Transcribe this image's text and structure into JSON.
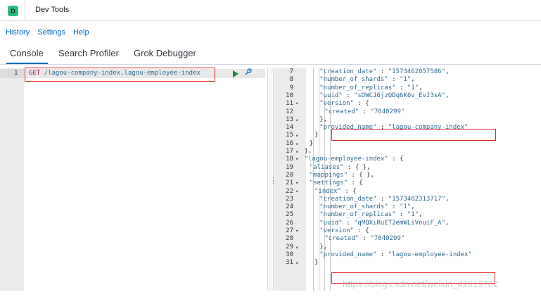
{
  "app": {
    "badge": "D",
    "title": "Dev Tools"
  },
  "menu": [
    "History",
    "Settings",
    "Help"
  ],
  "tabs": [
    "Console",
    "Search Profiler",
    "Grok Debugger"
  ],
  "request": {
    "line_number": "1",
    "method": "GET",
    "path": " /lagou-company-index,lagou-employee-index"
  },
  "response": {
    "lines": [
      {
        "n": "7",
        "fold": "",
        "indent": 6,
        "text": [
          [
            "k",
            "\"creation_date\""
          ],
          [
            "p",
            " : "
          ],
          [
            "s",
            "\"1573462057586\""
          ],
          [
            "p",
            ","
          ]
        ]
      },
      {
        "n": "8",
        "fold": "",
        "indent": 6,
        "text": [
          [
            "k",
            "\"number_of_shards\""
          ],
          [
            "p",
            " : "
          ],
          [
            "s",
            "\"1\""
          ],
          [
            "p",
            ","
          ]
        ]
      },
      {
        "n": "9",
        "fold": "",
        "indent": 6,
        "text": [
          [
            "k",
            "\"number_of_replicas\""
          ],
          [
            "p",
            " : "
          ],
          [
            "s",
            "\"1\""
          ],
          [
            "p",
            ","
          ]
        ]
      },
      {
        "n": "10",
        "fold": "",
        "indent": 6,
        "text": [
          [
            "k",
            "\"uuid\""
          ],
          [
            "p",
            " : "
          ],
          [
            "s",
            "\"sDWCJ6jzQDq6K6v_EvJ3sA\""
          ],
          [
            "p",
            ","
          ]
        ]
      },
      {
        "n": "11",
        "fold": "▾",
        "indent": 6,
        "text": [
          [
            "k",
            "\"version\""
          ],
          [
            "p",
            " : {"
          ]
        ]
      },
      {
        "n": "12",
        "fold": "",
        "indent": 7,
        "text": [
          [
            "k",
            "\"created\""
          ],
          [
            "p",
            " : "
          ],
          [
            "s",
            "\"7040299\""
          ]
        ]
      },
      {
        "n": "13",
        "fold": "▴",
        "indent": 6,
        "text": [
          [
            "p",
            "},"
          ]
        ]
      },
      {
        "n": "14",
        "fold": "",
        "indent": 6,
        "text": [
          [
            "k",
            "\"provided_name\""
          ],
          [
            "p",
            " : "
          ],
          [
            "s",
            "\"lagou-company-index\""
          ]
        ]
      },
      {
        "n": "15",
        "fold": "▴",
        "indent": 5,
        "text": [
          [
            "p",
            "}"
          ]
        ]
      },
      {
        "n": "16",
        "fold": "▴",
        "indent": 4,
        "text": [
          [
            "p",
            "}"
          ]
        ]
      },
      {
        "n": "17",
        "fold": "▴",
        "indent": 3,
        "text": [
          [
            "p",
            "},"
          ]
        ]
      },
      {
        "n": "18",
        "fold": "▾",
        "indent": 3,
        "text": [
          [
            "k",
            "\"lagou-employee-index\""
          ],
          [
            "p",
            " : {"
          ]
        ]
      },
      {
        "n": "19",
        "fold": "",
        "indent": 4,
        "text": [
          [
            "k",
            "\"aliases\""
          ],
          [
            "p",
            " : { },"
          ]
        ]
      },
      {
        "n": "20",
        "fold": "",
        "indent": 4,
        "text": [
          [
            "k",
            "\"mappings\""
          ],
          [
            "p",
            " : { },"
          ]
        ]
      },
      {
        "n": "21",
        "fold": "▾",
        "indent": 4,
        "text": [
          [
            "k",
            "\"settings\""
          ],
          [
            "p",
            " : {"
          ]
        ]
      },
      {
        "n": "22",
        "fold": "▾",
        "indent": 5,
        "text": [
          [
            "k",
            "\"index\""
          ],
          [
            "p",
            " : {"
          ]
        ]
      },
      {
        "n": "23",
        "fold": "",
        "indent": 6,
        "text": [
          [
            "k",
            "\"creation_date\""
          ],
          [
            "p",
            " : "
          ],
          [
            "s",
            "\"1573462313717\""
          ],
          [
            "p",
            ","
          ]
        ]
      },
      {
        "n": "24",
        "fold": "",
        "indent": 6,
        "text": [
          [
            "k",
            "\"number_of_shards\""
          ],
          [
            "p",
            " : "
          ],
          [
            "s",
            "\"1\""
          ],
          [
            "p",
            ","
          ]
        ]
      },
      {
        "n": "25",
        "fold": "",
        "indent": 6,
        "text": [
          [
            "k",
            "\"number_of_replicas\""
          ],
          [
            "p",
            " : "
          ],
          [
            "s",
            "\"1\""
          ],
          [
            "p",
            ","
          ]
        ]
      },
      {
        "n": "26",
        "fold": "",
        "indent": 6,
        "text": [
          [
            "k",
            "\"uuid\""
          ],
          [
            "p",
            " : "
          ],
          [
            "s",
            "\"qMQXiRuET2emWLiVnuiF_A\""
          ],
          [
            "p",
            ","
          ]
        ]
      },
      {
        "n": "27",
        "fold": "▾",
        "indent": 6,
        "text": [
          [
            "k",
            "\"version\""
          ],
          [
            "p",
            " : {"
          ]
        ]
      },
      {
        "n": "28",
        "fold": "",
        "indent": 7,
        "text": [
          [
            "k",
            "\"created\""
          ],
          [
            "p",
            " : "
          ],
          [
            "s",
            "\"7040299\""
          ]
        ]
      },
      {
        "n": "29",
        "fold": "▴",
        "indent": 6,
        "text": [
          [
            "p",
            "},"
          ]
        ]
      },
      {
        "n": "30",
        "fold": "",
        "indent": 6,
        "text": [
          [
            "k",
            "\"provided_name\""
          ],
          [
            "p",
            " : "
          ],
          [
            "s",
            "\"lagou-employee-index\""
          ]
        ]
      },
      {
        "n": "31",
        "fold": "▴",
        "indent": 5,
        "text": [
          [
            "p",
            "}"
          ]
        ]
      }
    ]
  },
  "watermark": "https://blog.csdn.net/weixin_42013762",
  "colors": {
    "accent": "#006bb4",
    "method": "#c80a68",
    "string": "#2e6a8e",
    "highlight_box": "#e02020",
    "run": "#1a8a4a"
  }
}
